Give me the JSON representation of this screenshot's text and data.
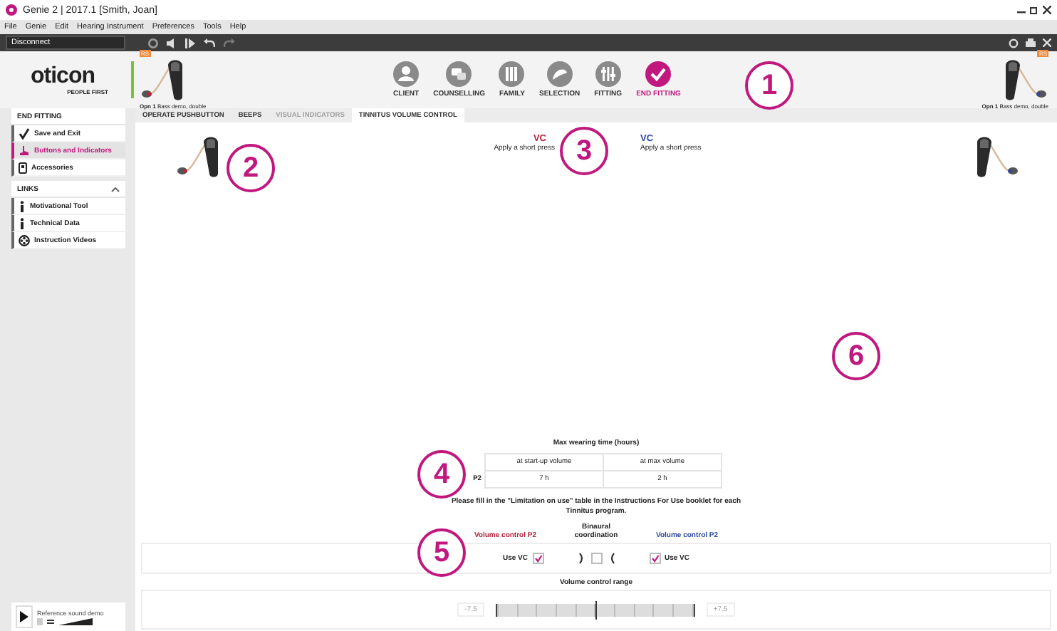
{
  "window": {
    "title": "Genie 2 | 2017.1 [Smith, Joan]"
  },
  "menu": [
    "File",
    "Genie",
    "Edit",
    "Hearing Instrument",
    "Preferences",
    "Tools",
    "Help"
  ],
  "toolbar": {
    "connection": "Disconnect"
  },
  "header": {
    "logo": "oticon",
    "tagline": "PEOPLE FIRST",
    "devices": [
      {
        "badge": "RS",
        "model": "Opn 1",
        "program": "Bass demo, double"
      },
      {
        "badge": "RS",
        "model": "Opn 1",
        "program": "Bass demo, double"
      }
    ],
    "nav": [
      {
        "label": "CLIENT",
        "selected": false
      },
      {
        "label": "COUNSELLING",
        "selected": false
      },
      {
        "label": "FAMILY",
        "selected": false
      },
      {
        "label": "SELECTION",
        "selected": false
      },
      {
        "label": "FITTING",
        "selected": false
      },
      {
        "label": "END FITTING",
        "selected": true
      }
    ]
  },
  "sidebar": {
    "sections": [
      {
        "title": "END FITTING",
        "collapsible": false,
        "items": [
          {
            "label": "Save and Exit",
            "kind": "check",
            "selected": false
          },
          {
            "label": "Buttons and Indicators",
            "kind": "hand",
            "selected": true
          },
          {
            "label": "Accessories",
            "kind": "phone",
            "selected": false
          }
        ]
      },
      {
        "title": "LINKS",
        "collapsible": true,
        "items": [
          {
            "label": "Motivational Tool",
            "kind": "info",
            "selected": false
          },
          {
            "label": "Technical Data",
            "kind": "info",
            "selected": false
          },
          {
            "label": "Instruction Videos",
            "kind": "video",
            "selected": false
          }
        ]
      }
    ],
    "demo": {
      "label": "Reference sound demo"
    }
  },
  "tabs": [
    {
      "label": "OPERATE PUSHBUTTON",
      "selected": false,
      "disabled": false
    },
    {
      "label": "BEEPS",
      "selected": false,
      "disabled": false
    },
    {
      "label": "VISUAL INDICATORS",
      "selected": false,
      "disabled": true
    },
    {
      "label": "TINNITUS VOLUME CONTROL",
      "selected": true,
      "disabled": false
    }
  ],
  "controls": [
    {
      "title": "VC",
      "action": "Apply a short press",
      "color": "#b0243c"
    },
    {
      "title": "VC",
      "action": "Apply a short press",
      "color": "#2b4aa0"
    }
  ],
  "wearing_time": {
    "title": "Max wearing time (hours)",
    "columns": [
      "at start-up volume",
      "at max volume"
    ],
    "rows": [
      {
        "program": "P2",
        "values": [
          "7 h",
          "2 h"
        ]
      }
    ]
  },
  "note": "Please fill in the \"Limitation on use\" table in the Instructions For Use booklet for each Tinnitus program.",
  "volume_controls": {
    "left": {
      "title": "Volume control P2",
      "label": "Use VC",
      "checked": true,
      "color": "#b0243c"
    },
    "binaural": {
      "title": "Binaural coordination",
      "checked": false
    },
    "right": {
      "title": "Volume control P2",
      "label": "Use VC",
      "checked": true,
      "color": "#2b4aa0"
    }
  },
  "range": {
    "title": "Volume control range",
    "min": "-7.5",
    "max": "+7.5",
    "level": 0.5
  },
  "callouts": [
    "1",
    "2",
    "3",
    "4",
    "5",
    "6"
  ]
}
